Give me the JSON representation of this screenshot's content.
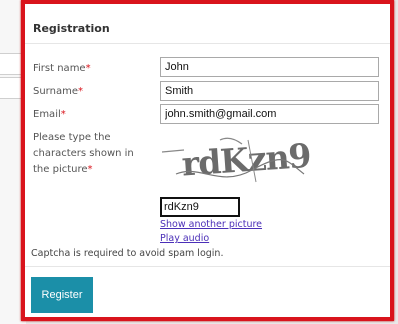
{
  "form": {
    "title": "Registration",
    "first_name": {
      "label": "First name",
      "required": "*",
      "value": "John"
    },
    "surname": {
      "label": "Surname",
      "required": "*",
      "value": "Smith"
    },
    "email": {
      "label": "Email",
      "required": "*",
      "value": "john.smith@gmail.com"
    },
    "captcha": {
      "label": "Please type the characters shown in the picture",
      "required": "*",
      "image_text": "rdKzn9",
      "value": "rdKzn9",
      "show_another": "Show another picture",
      "play_audio": "Play audio"
    },
    "note": "Captcha is required to avoid spam login.",
    "submit_label": "Register"
  },
  "colors": {
    "frame": "#d9141c",
    "button": "#1b8fa8",
    "link": "#4b2fb8"
  }
}
